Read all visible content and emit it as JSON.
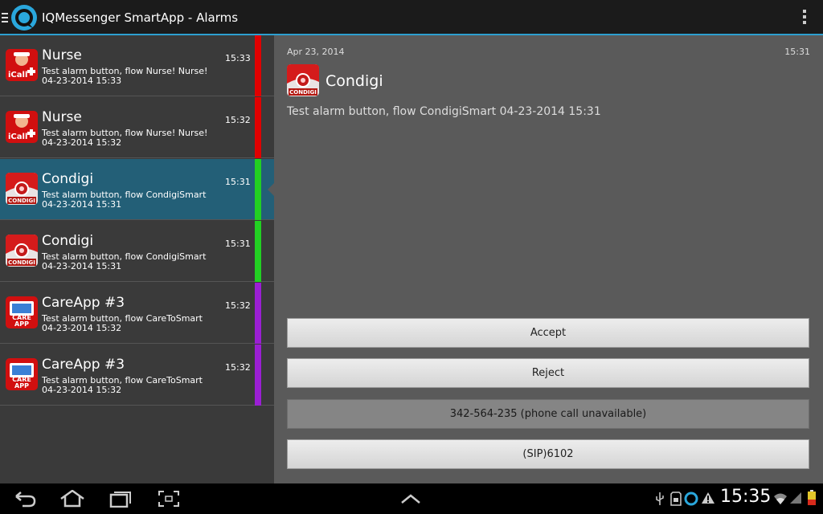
{
  "app_bar": {
    "title": "IQMessenger SmartApp - Alarms",
    "icons": [
      "up-menu-icon",
      "app-logo-icon",
      "overflow-menu-icon"
    ]
  },
  "alarms": [
    {
      "title": "Nurse",
      "time": "15:33",
      "message": "Test alarm button, flow Nurse! Nurse!",
      "timestamp": "04-23-2014 15:33",
      "icon": "icall-icon",
      "color": "#e00000",
      "selected": false
    },
    {
      "title": "Nurse",
      "time": "15:32",
      "message": "Test alarm button, flow Nurse! Nurse!",
      "timestamp": "04-23-2014 15:32",
      "icon": "icall-icon",
      "color": "#e00000",
      "selected": false
    },
    {
      "title": "Condigi",
      "time": "15:31",
      "message": "Test alarm button, flow CondigiSmart",
      "timestamp": "04-23-2014 15:31",
      "icon": "condigi-icon",
      "color": "#22d022",
      "selected": true
    },
    {
      "title": "Condigi",
      "time": "15:31",
      "message": "Test alarm button, flow CondigiSmart",
      "timestamp": "04-23-2014 15:31",
      "icon": "condigi-icon",
      "color": "#22d022",
      "selected": false
    },
    {
      "title": "CareApp #3",
      "time": "15:32",
      "message": "Test alarm button, flow CareToSmart",
      "timestamp": "04-23-2014 15:32",
      "icon": "careapp-icon",
      "color": "#9b1fd4",
      "selected": false
    },
    {
      "title": "CareApp #3",
      "time": "15:32",
      "message": "Test alarm button, flow CareToSmart",
      "timestamp": "04-23-2014 15:32",
      "icon": "careapp-icon",
      "color": "#9b1fd4",
      "selected": false
    }
  ],
  "icon_labels": {
    "icall": "iCall",
    "condigi": "CONDIGI",
    "care": "CARE",
    "app": "APP"
  },
  "detail": {
    "date": "Apr 23, 2014",
    "time": "15:31",
    "title": "Condigi",
    "message": "Test alarm button, flow CondigiSmart 04-23-2014 15:31",
    "icon": "condigi-icon",
    "buttons": {
      "accept": "Accept",
      "reject": "Reject",
      "phone": "342-564-235 (phone call unavailable)",
      "sip": "(SIP)6102"
    }
  },
  "status_bar": {
    "clock": "15:35",
    "icons": [
      "back-icon",
      "home-icon",
      "recent-apps-icon",
      "screenshot-icon",
      "up-arrow-icon",
      "usb-icon",
      "sd-card-icon",
      "app-status-icon",
      "warning-icon",
      "wifi-icon",
      "signal-icon",
      "battery-icon"
    ]
  },
  "colors": {
    "accent": "#2d9fd0",
    "selected_row": "#235f77",
    "alarm_red": "#e00000",
    "alarm_green": "#22d022",
    "alarm_purple": "#9b1fd4"
  }
}
